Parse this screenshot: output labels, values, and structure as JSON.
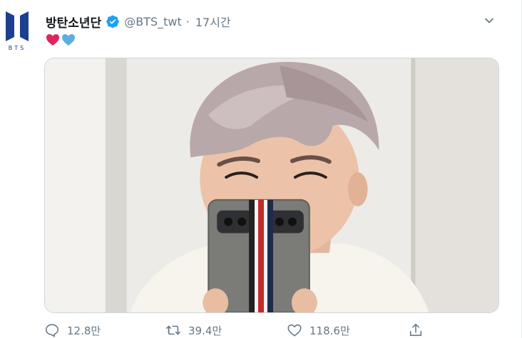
{
  "author": {
    "display_name": "방탄소년단",
    "handle": "@BTS_twt",
    "separator": "·",
    "time": "17시간",
    "avatar_logo_text": "BTS",
    "verified_icon": "verified-badge-icon"
  },
  "tweet": {
    "emojis": [
      "red-heart-emoji",
      "blue-heart-emoji"
    ]
  },
  "actions": {
    "reply_count": "12.8만",
    "retweet_count": "39.4만",
    "like_count": "118.6만"
  },
  "colors": {
    "verified": "#1da1f2",
    "muted_text": "#657786",
    "avatar_logo": "#1c3f8f",
    "red_heart": "#e0245e",
    "blue_heart": "#5dade2"
  }
}
